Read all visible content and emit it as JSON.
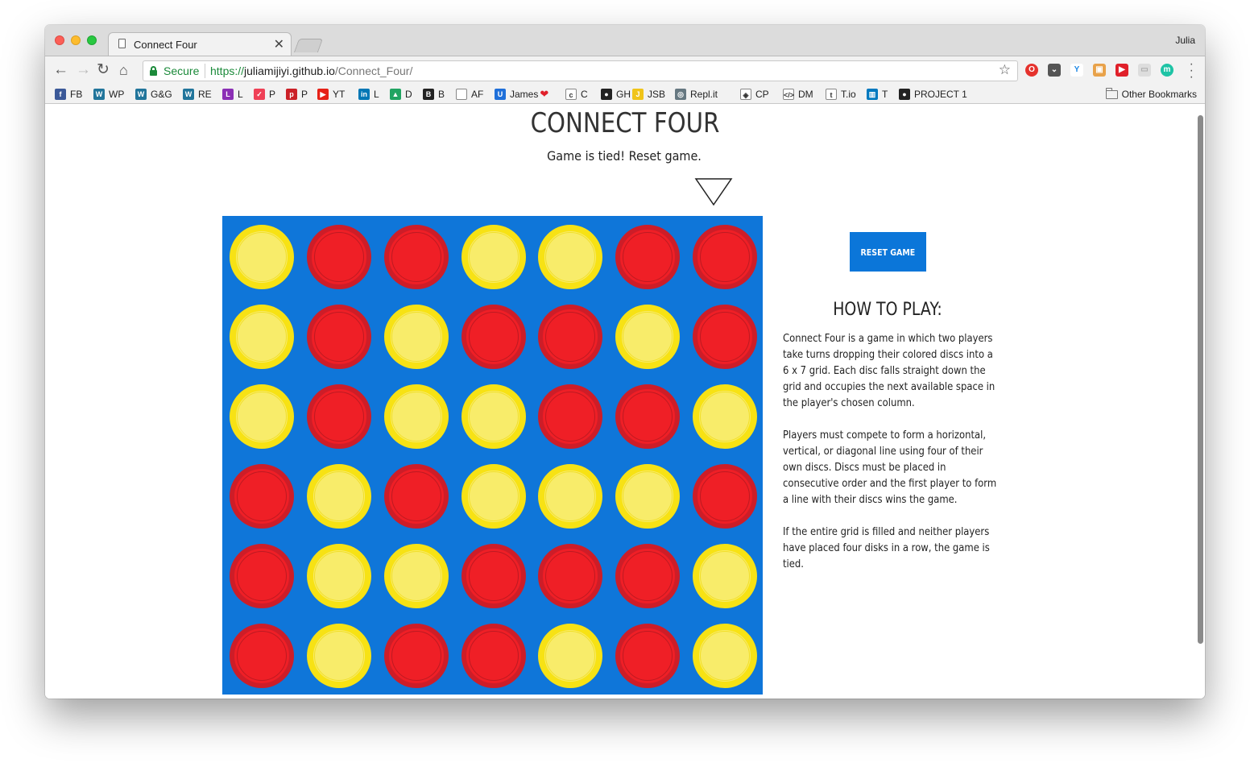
{
  "browser": {
    "tab_title": "Connect Four",
    "tab_close": "✕",
    "profile_name": "Julia",
    "secure_label": "Secure",
    "url_scheme": "https://",
    "url_host": "juliamijiyi.github.io",
    "url_path": "/Connect_Four/",
    "bookmarks": [
      {
        "label": "FB",
        "icon": "facebook-icon",
        "color": "#3b5998",
        "glyph": "f"
      },
      {
        "label": "WP",
        "icon": "wordpress-icon",
        "color": "#21759b",
        "glyph": "W"
      },
      {
        "label": "G&G",
        "icon": "wordpress-icon",
        "color": "#21759b",
        "glyph": "W"
      },
      {
        "label": "RE",
        "icon": "wordpress-icon",
        "color": "#21759b",
        "glyph": "W"
      },
      {
        "label": "L",
        "icon": "l-icon",
        "color": "#8b2fb5",
        "glyph": "L"
      },
      {
        "label": "P",
        "icon": "pocket-icon",
        "color": "#ef4056",
        "glyph": "✓"
      },
      {
        "label": "P",
        "icon": "pinterest-icon",
        "color": "#cb2027",
        "glyph": "p"
      },
      {
        "label": "YT",
        "icon": "youtube-icon",
        "color": "#e62117",
        "glyph": "▶"
      },
      {
        "label": "L",
        "icon": "linkedin-icon",
        "color": "#0077b5",
        "glyph": "in"
      },
      {
        "label": "D",
        "icon": "drive-icon",
        "color": "#21a462",
        "glyph": "▲"
      },
      {
        "label": "B",
        "icon": "b-icon",
        "color": "#222222",
        "glyph": "B"
      },
      {
        "label": "AF",
        "icon": "page-icon",
        "color": "#ffffff",
        "glyph": ""
      },
      {
        "label": "James",
        "icon": "u-icon",
        "color": "#1e6fd9",
        "glyph": "U",
        "heart": "❤"
      },
      {
        "label": "C",
        "icon": "c-icon",
        "color": "#ffffff",
        "glyph": "c"
      },
      {
        "label": "GH",
        "icon": "github-icon",
        "color": "#222222",
        "glyph": "●"
      },
      {
        "label": "JSB",
        "icon": "jsbin-icon",
        "color": "#f0c419",
        "glyph": "J"
      },
      {
        "label": "Repl.it",
        "icon": "replit-icon",
        "color": "#667881",
        "glyph": "◎"
      },
      {
        "label": "CP",
        "icon": "codepen-icon",
        "color": "#ffffff",
        "glyph": "◈"
      },
      {
        "label": "DM",
        "icon": "code-icon",
        "color": "#ffffff",
        "glyph": "</>"
      },
      {
        "label": "T.io",
        "icon": "t-icon",
        "color": "#ffffff",
        "glyph": "t"
      },
      {
        "label": "T",
        "icon": "trello-icon",
        "color": "#0079bf",
        "glyph": "▥"
      },
      {
        "label": "PROJECT 1",
        "icon": "github-icon",
        "color": "#222222",
        "glyph": "●"
      }
    ],
    "other_bookmarks": "Other Bookmarks"
  },
  "page": {
    "title": "CONNECT FOUR",
    "status": "Game is tied! Reset game.",
    "reset_label": "RESET GAME",
    "howto_title": "HOW TO PLAY:",
    "rules": [
      "Connect Four is a game in which two players take turns dropping their colored discs into a 6 x 7 grid. Each disc falls straight down the grid and occupies the next available space in the player's chosen column.",
      "Players must compete to form a horizontal, vertical, or diagonal line using four of their own discs. Discs must be placed in consecutive order and the first player to form a line with their discs wins the game.",
      "If the entire grid is filled and neither players have placed four disks in a row, the game is tied."
    ]
  },
  "board": {
    "rows": 6,
    "cols": 7,
    "color_board": "#0f76d9",
    "color_red": "#ef1f26",
    "color_yellow": "#f8ec6a",
    "cells": [
      [
        "yellow",
        "red",
        "red",
        "yellow",
        "yellow",
        "red",
        "red"
      ],
      [
        "yellow",
        "red",
        "yellow",
        "red",
        "red",
        "yellow",
        "red"
      ],
      [
        "yellow",
        "red",
        "yellow",
        "yellow",
        "red",
        "red",
        "yellow"
      ],
      [
        "red",
        "yellow",
        "red",
        "yellow",
        "yellow",
        "yellow",
        "red"
      ],
      [
        "red",
        "yellow",
        "yellow",
        "red",
        "red",
        "red",
        "yellow"
      ],
      [
        "red",
        "yellow",
        "red",
        "red",
        "yellow",
        "red",
        "yellow"
      ]
    ],
    "drop_indicator_column": 7
  }
}
